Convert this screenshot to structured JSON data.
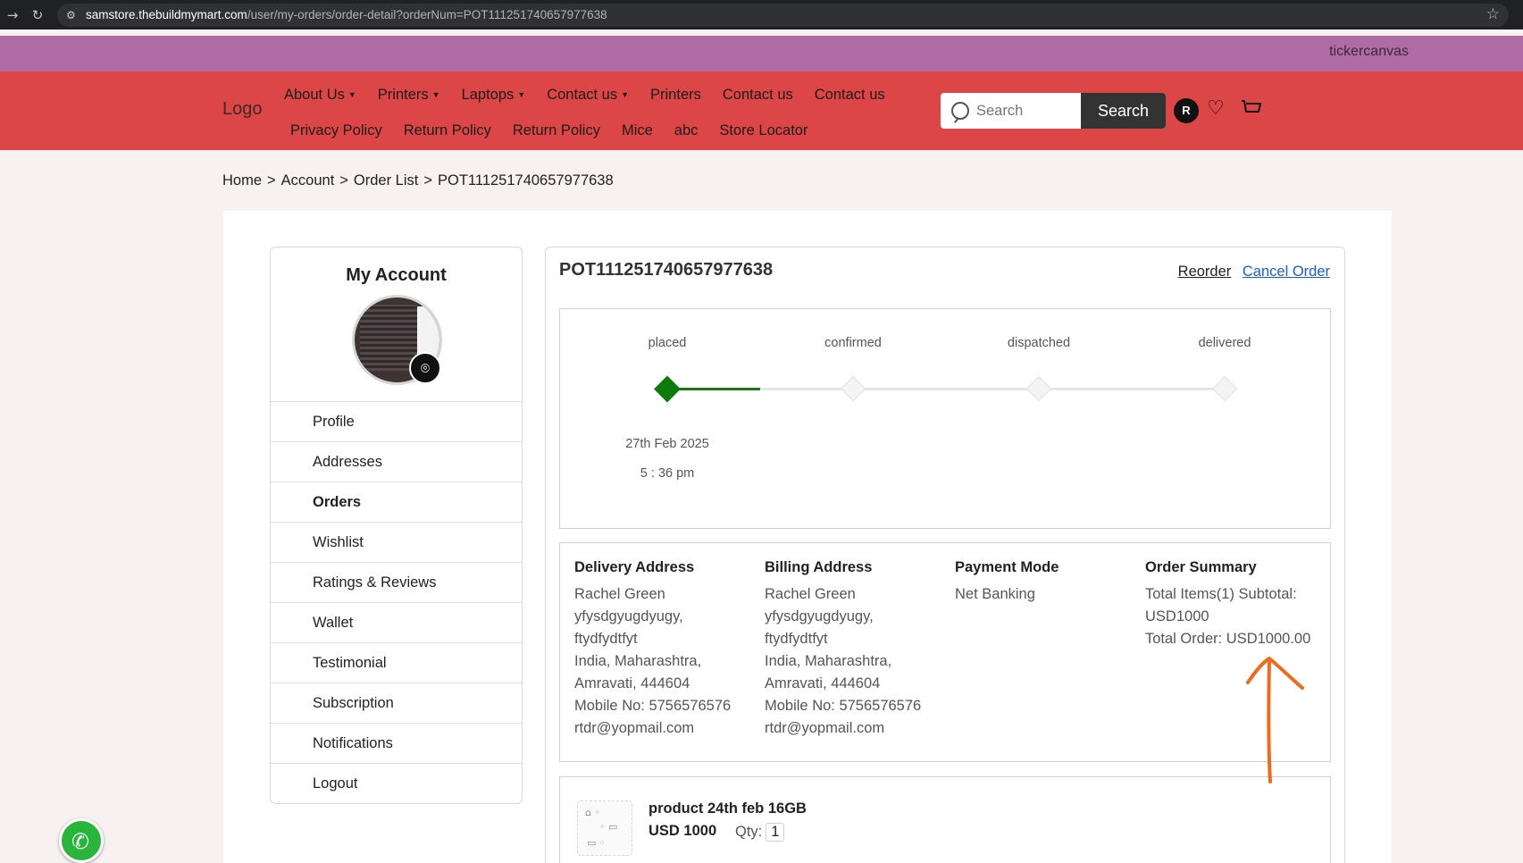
{
  "browser": {
    "url_host": "samstore.thebuildmymart.com",
    "url_path": "/user/my-orders/order-detail?orderNum=POT111251740657977638"
  },
  "ticker": {
    "text": "tickercanvas"
  },
  "header": {
    "logo": "Logo",
    "menu_row1": [
      {
        "label": "About Us",
        "dropdown": true
      },
      {
        "label": "Printers",
        "dropdown": true
      },
      {
        "label": "Laptops",
        "dropdown": true
      },
      {
        "label": "Contact us",
        "dropdown": true
      },
      {
        "label": "Printers",
        "dropdown": false
      },
      {
        "label": "Contact us",
        "dropdown": false
      },
      {
        "label": "Contact us",
        "dropdown": false
      }
    ],
    "menu_row2": [
      {
        "label": "Privacy Policy"
      },
      {
        "label": "Return Policy"
      },
      {
        "label": "Return Policy"
      },
      {
        "label": "Mice"
      },
      {
        "label": "abc"
      },
      {
        "label": "Store Locator"
      }
    ],
    "search_placeholder": "Search",
    "search_button": "Search",
    "user_initial": "R",
    "colors": {
      "ticker": "#b06ba4",
      "header": "#dc4646",
      "button": "#333333"
    }
  },
  "breadcrumb": {
    "home": "Home",
    "account": "Account",
    "order_list": "Order List",
    "current": "POT111251740657977638"
  },
  "sidebar": {
    "title": "My Account",
    "items": [
      {
        "label": "Profile",
        "active": false
      },
      {
        "label": "Addresses",
        "active": false
      },
      {
        "label": "Orders",
        "active": true
      },
      {
        "label": "Wishlist",
        "active": false
      },
      {
        "label": "Ratings & Reviews",
        "active": false
      },
      {
        "label": "Wallet",
        "active": false
      },
      {
        "label": "Testimonial",
        "active": false
      },
      {
        "label": "Subscription",
        "active": false
      },
      {
        "label": "Notifications",
        "active": false
      },
      {
        "label": "Logout",
        "active": false
      }
    ]
  },
  "order": {
    "number": "POT111251740657977638",
    "reorder_label": "Reorder",
    "cancel_label": "Cancel Order",
    "steps": [
      {
        "label": "placed",
        "done": true,
        "date": "27th Feb 2025",
        "time": "5 : 36 pm"
      },
      {
        "label": "confirmed",
        "done": false
      },
      {
        "label": "dispatched",
        "done": false
      },
      {
        "label": "delivered",
        "done": false
      }
    ],
    "delivery": {
      "heading": "Delivery Address",
      "lines": [
        "Rachel Green",
        "yfysdgyugdyugy,",
        "ftydfydtfyt",
        "India, Maharashtra,",
        "Amravati, 444604",
        "Mobile No: 5756576576",
        "rtdr@yopmail.com"
      ]
    },
    "billing": {
      "heading": "Billing Address",
      "lines": [
        "Rachel Green",
        "yfysdgyugdyugy,",
        "ftydfydtfyt",
        "India, Maharashtra,",
        "Amravati, 444604",
        "Mobile No: 5756576576",
        "rtdr@yopmail.com"
      ]
    },
    "payment": {
      "heading": "Payment Mode",
      "lines": [
        "Net Banking"
      ]
    },
    "summary": {
      "heading": "Order Summary",
      "lines": [
        "Total Items(1) Subtotal:",
        "USD1000",
        "Total Order: USD1000.00"
      ]
    },
    "product": {
      "name": "product 24th feb 16GB",
      "price": "USD 1000",
      "qty_label": "Qty:",
      "qty": "1"
    }
  }
}
